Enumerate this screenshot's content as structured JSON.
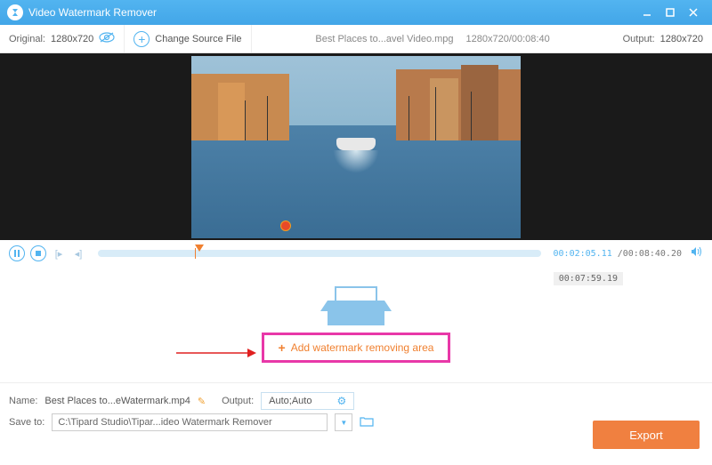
{
  "titlebar": {
    "app_name": "Video Watermark Remover"
  },
  "toolbar": {
    "original_label": "Original:",
    "original_res": "1280x720",
    "change_source": "Change Source File",
    "file_name": "Best Places to...avel Video.mpg",
    "file_meta": "1280x720/00:08:40",
    "output_label": "Output:",
    "output_res": "1280x720"
  },
  "player": {
    "current_time": "00:02:05.11",
    "duration": "/00:08:40.20",
    "hover_time": "00:07:59.19"
  },
  "tray": {
    "add_button": "Add watermark removing area"
  },
  "bottom": {
    "name_label": "Name:",
    "name_value": "Best Places to...eWatermark.mp4",
    "output_label": "Output:",
    "output_value": "Auto;Auto",
    "save_label": "Save to:",
    "save_path": "C:\\Tipard Studio\\Tipar...ideo Watermark Remover",
    "export": "Export"
  }
}
